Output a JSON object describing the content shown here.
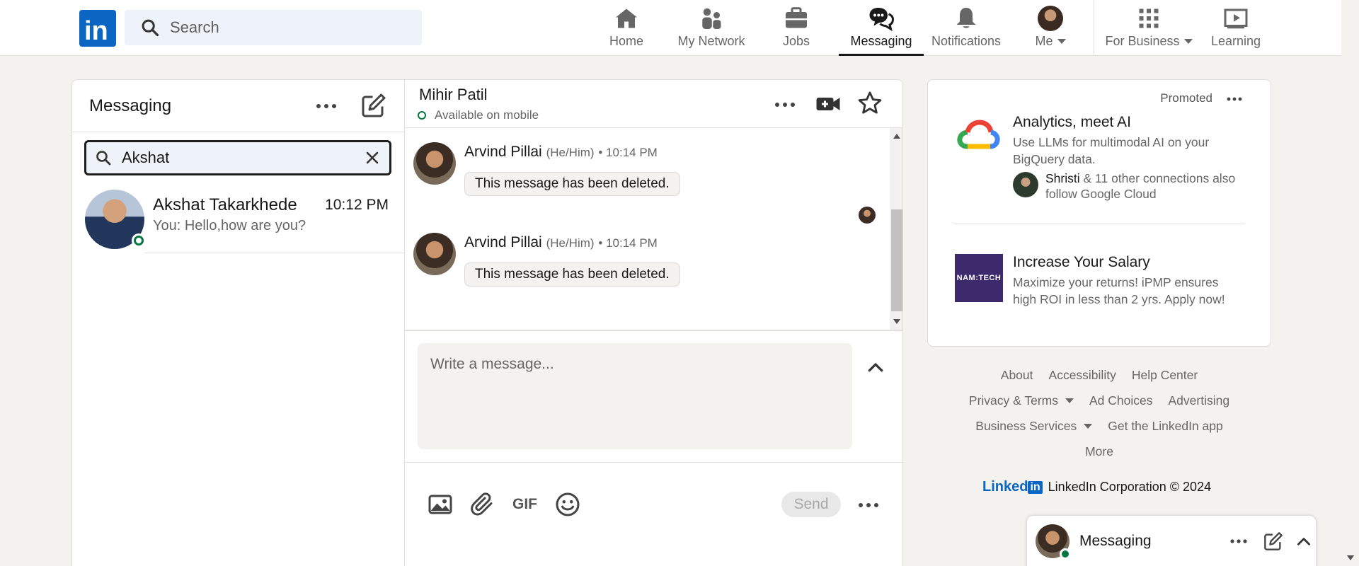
{
  "colors": {
    "brand": "#0a66c2",
    "online": "#057642",
    "background": "#f4f2ee"
  },
  "nav": {
    "logo_text": "in",
    "search_placeholder": "Search",
    "items": [
      {
        "label": "Home",
        "icon": "home-icon"
      },
      {
        "label": "My Network",
        "icon": "network-icon"
      },
      {
        "label": "Jobs",
        "icon": "briefcase-icon"
      },
      {
        "label": "Messaging",
        "icon": "messaging-icon",
        "active": true
      },
      {
        "label": "Notifications",
        "icon": "bell-icon"
      },
      {
        "label": "Me",
        "icon": "avatar"
      },
      {
        "label": "For Business",
        "icon": "grid-icon"
      },
      {
        "label": "Learning",
        "icon": "learning-icon"
      }
    ]
  },
  "messaging": {
    "title": "Messaging",
    "search_value": "Akshat",
    "conversations": [
      {
        "name": "Akshat Takarkhede",
        "time": "10:12 PM",
        "snippet": "You: Hello,how are you?",
        "online": true
      }
    ]
  },
  "thread": {
    "name": "Mihir Patil",
    "status": "Available on mobile",
    "messages": [
      {
        "sender": "Arvind Pillai",
        "pronouns": "(He/Him)",
        "time": "• 10:14 PM",
        "text": "This message has been deleted."
      },
      {
        "sender": "Arvind Pillai",
        "pronouns": "(He/Him)",
        "time": "• 10:14 PM",
        "text": "This message has been deleted."
      }
    ],
    "composer_placeholder": "Write a message...",
    "gif_label": "GIF",
    "send_label": "Send"
  },
  "ad": {
    "promoted_label": "Promoted",
    "items": [
      {
        "title": "Analytics, meet AI",
        "body": "Use LLMs for multimodal AI on your BigQuery data.",
        "social_name": "Shristi",
        "social_rest": "& 11 other connections also follow Google Cloud"
      },
      {
        "title": "Increase Your Salary",
        "body": "Maximize your returns! iPMP ensures high ROI in less than 2 yrs. Apply now!",
        "logo_text": "NAM:TECH"
      }
    ]
  },
  "footer": {
    "links": [
      "About",
      "Accessibility",
      "Help Center",
      "Privacy & Terms",
      "Ad Choices",
      "Advertising",
      "Business Services",
      "Get the LinkedIn app",
      "More"
    ],
    "brand_word": "Linked",
    "brand_box": "in",
    "copyright": "LinkedIn Corporation © 2024"
  },
  "mini_messaging": {
    "label": "Messaging"
  }
}
